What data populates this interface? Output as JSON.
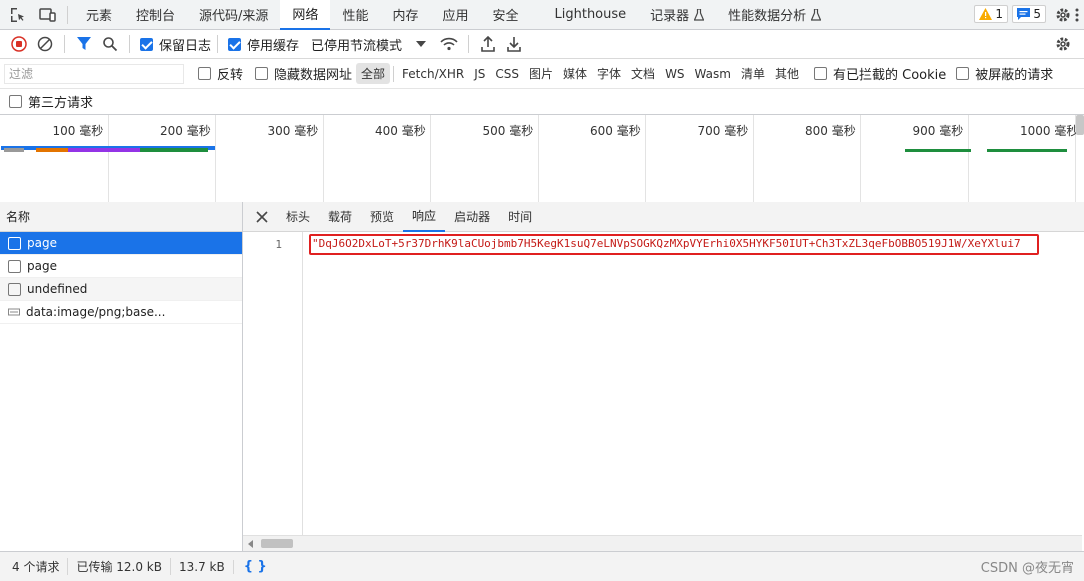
{
  "tabs": [
    "元素",
    "控制台",
    "源代码/来源",
    "网络",
    "性能",
    "内存",
    "应用",
    "安全",
    "Lighthouse",
    "记录器",
    "性能数据分析"
  ],
  "active_tab": "网络",
  "badges": {
    "warnings": "1",
    "messages": "5"
  },
  "toolbar": {
    "preserve_log": "保留日志",
    "disable_cache": "停用缓存",
    "throttling": "已停用节流模式"
  },
  "filter": {
    "placeholder": "过滤",
    "invert": "反转",
    "hide_data_urls": "隐藏数据网址",
    "types": [
      "全部",
      "Fetch/XHR",
      "JS",
      "CSS",
      "图片",
      "媒体",
      "字体",
      "文档",
      "WS",
      "Wasm",
      "清单",
      "其他"
    ],
    "blocked_cookies": "有已拦截的 Cookie",
    "blocked_requests": "被屏蔽的请求",
    "third_party": "第三方请求"
  },
  "timeline": {
    "ticks": [
      "100 毫秒",
      "200 毫秒",
      "300 毫秒",
      "400 毫秒",
      "500 毫秒",
      "600 毫秒",
      "700 毫秒",
      "800 毫秒",
      "900 毫秒",
      "1000 毫秒"
    ]
  },
  "request_list": {
    "header": "名称",
    "rows": [
      "page",
      "page",
      "undefined",
      "data:image/png;base..."
    ]
  },
  "detail_tabs": [
    "标头",
    "载荷",
    "预览",
    "响应",
    "启动器",
    "时间"
  ],
  "active_detail_tab": "响应",
  "response": {
    "line_number": "1",
    "content": "\"DqJ6O2DxLoT+5r37DrhK9laCUojbmb7H5KegK1suQ7eLNVpSOGKQzMXpVYErhi0X5HYKF50IUT+Ch3TxZL3qeFbOBBO519J1W/XeYXlui7"
  },
  "status": {
    "requests": "4 个请求",
    "transferred": "已传输 12.0 kB",
    "resources": "13.7 kB",
    "format_icon": "{ }"
  },
  "watermark": "CSDN @夜无宵",
  "colors": {
    "accent": "#1a73e8",
    "record": "#d93025",
    "highlight_box": "#e02020",
    "string": "#c41a16"
  }
}
